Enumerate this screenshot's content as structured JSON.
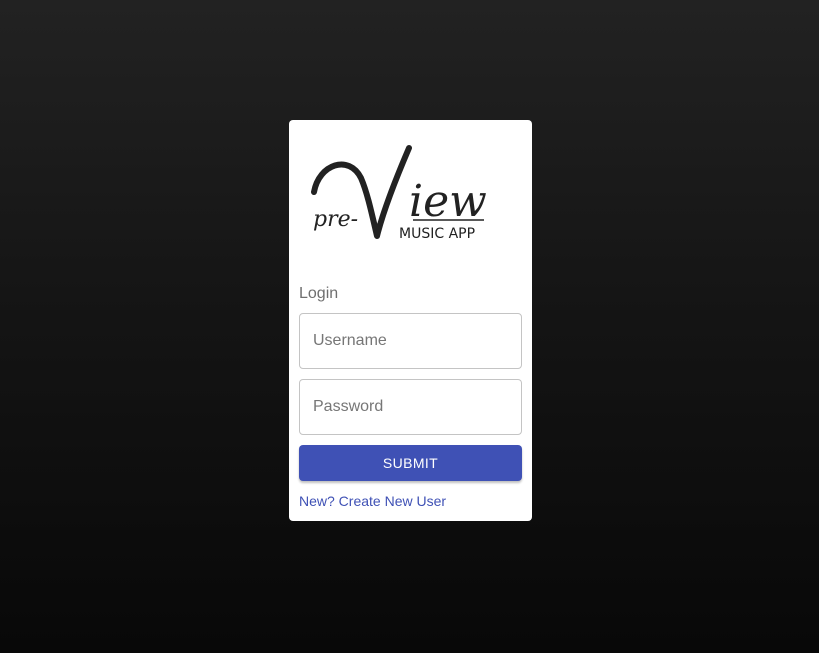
{
  "logo": {
    "prefix": "pre-",
    "initial": "V",
    "rest": "iew",
    "subtitle": "MUSIC APP"
  },
  "form": {
    "heading": "Login",
    "username_placeholder": "Username",
    "password_placeholder": "Password",
    "submit_label": "SUBMIT",
    "create_link": "New? Create New User"
  },
  "colors": {
    "accent": "#3f51b5",
    "background_top": "#222222",
    "background_bottom": "#080808",
    "card": "#ffffff"
  }
}
